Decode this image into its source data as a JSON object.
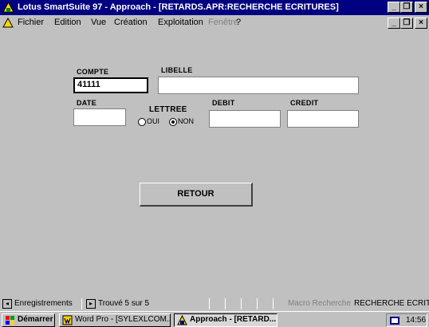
{
  "window": {
    "title": "Lotus SmartSuite 97  - Approach - [RETARDS.APR:RECHERCHE ECRITURES]",
    "minimize": "_",
    "restore": "❐",
    "close": "×"
  },
  "menu": {
    "items": [
      "Fichier",
      "Edition",
      "Vue",
      "Création",
      "Exploitation",
      "Fenêtre",
      "?"
    ]
  },
  "form": {
    "compte_label": "COMPTE",
    "compte_value": "41111",
    "libelle_label": "LIBELLE",
    "libelle_value": "",
    "date_label": "DATE",
    "date_value": "",
    "lettree_label": "LETTREE",
    "radio_oui": "OUI",
    "radio_non": "NON",
    "lettree_selected": "NON",
    "debit_label": "DEBIT",
    "debit_value": "",
    "credit_label": "CREDIT",
    "credit_value": "",
    "retour_label": "RETOUR"
  },
  "statusbar": {
    "enregistrements": "Enregistrements",
    "trouve": "Trouvé 5 sur 5",
    "macro": "Macro Recherche",
    "view": "RECHERCHE ECRITUR"
  },
  "taskbar": {
    "start": "Démarrer",
    "tasks": [
      "Word Pro - [SYLEXLCOM...",
      "Approach - [RETARD..."
    ],
    "clock": "14:56"
  },
  "colors": {
    "titlebar": "#000080",
    "face": "#c0c0c0"
  }
}
